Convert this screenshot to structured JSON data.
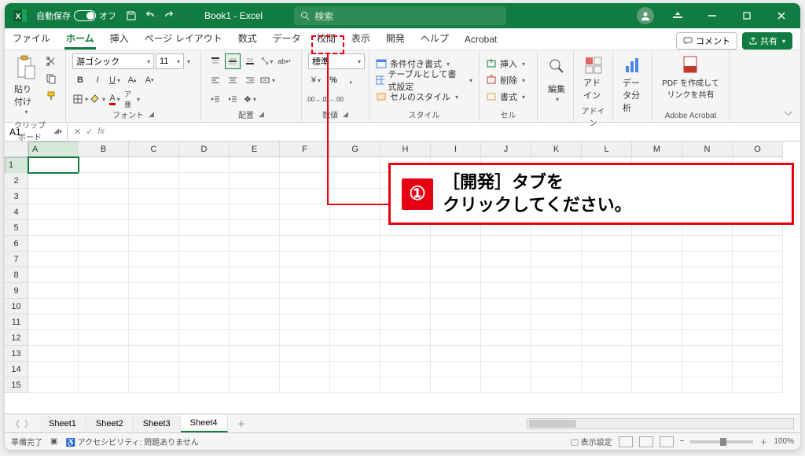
{
  "titlebar": {
    "autosave_label": "自動保存",
    "autosave_state": "オフ",
    "title": "Book1  -  Excel",
    "search_placeholder": "検索"
  },
  "tabs": {
    "items": [
      "ファイル",
      "ホーム",
      "挿入",
      "ページ レイアウト",
      "数式",
      "データ",
      "校閲",
      "表示",
      "開発",
      "ヘルプ",
      "Acrobat"
    ],
    "active_index": 1,
    "comment_label": "コメント",
    "share_label": "共有"
  },
  "ribbon": {
    "clipboard": {
      "paste": "貼り付け",
      "label": "クリップボード"
    },
    "font": {
      "name": "游ゴシック",
      "size": "11",
      "label": "フォント"
    },
    "align": {
      "label": "配置"
    },
    "number": {
      "format": "標準",
      "label": "数値"
    },
    "styles": {
      "cond": "条件付き書式",
      "table": "テーブルとして書式設定",
      "cell": "セルのスタイル",
      "label": "スタイル"
    },
    "cells": {
      "insert": "挿入",
      "delete": "削除",
      "format": "書式",
      "label": "セル"
    },
    "editing": {
      "label": "編集"
    },
    "addins": {
      "addin": "アドイン",
      "label": "アドイン"
    },
    "analysis": {
      "btn": "データ分析"
    },
    "acrobat": {
      "btn": "PDF を作成してリンクを共有",
      "label": "Adobe Acrobat"
    }
  },
  "formula": {
    "namebox": "A1"
  },
  "grid": {
    "columns": [
      "A",
      "B",
      "C",
      "D",
      "E",
      "F",
      "G",
      "H",
      "I",
      "J",
      "K",
      "L",
      "M",
      "N",
      "O"
    ],
    "rows": [
      "1",
      "2",
      "3",
      "4",
      "5",
      "6",
      "7",
      "8",
      "9",
      "10",
      "11",
      "12",
      "13",
      "14",
      "15"
    ],
    "active_cell": "A1"
  },
  "sheets": {
    "items": [
      "Sheet1",
      "Sheet2",
      "Sheet3",
      "Sheet4"
    ],
    "active_index": 3
  },
  "statusbar": {
    "ready": "準備完了",
    "accessibility": "アクセシビリティ: 問題ありません",
    "display": "表示設定",
    "zoom": "100%"
  },
  "annotation": {
    "num": "①",
    "text": "［開発］タブを\nクリックしてください。"
  },
  "colors": {
    "accent": "#107c41",
    "annot": "#e60012"
  }
}
